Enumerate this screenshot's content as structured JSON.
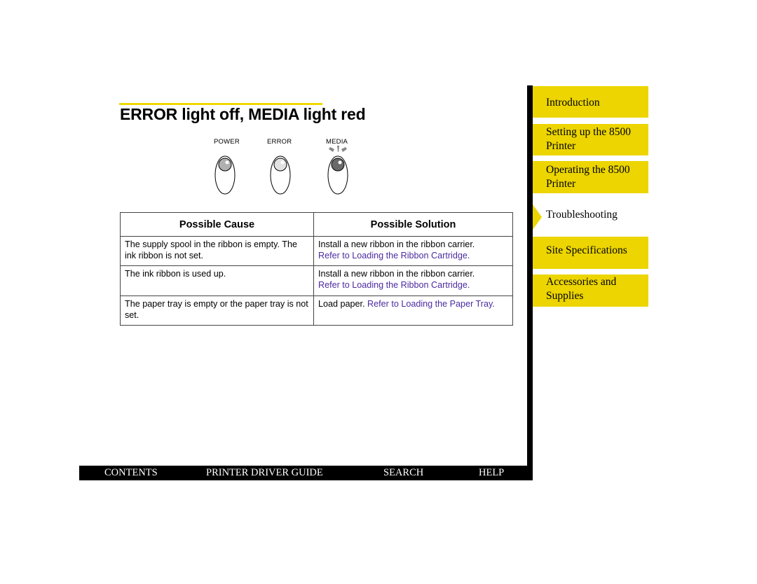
{
  "page": {
    "title": "ERROR light off, MEDIA light red"
  },
  "control_panel": {
    "leds": [
      {
        "label": "POWER",
        "state": "on",
        "color": "#b0b0b0"
      },
      {
        "label": "ERROR",
        "state": "off",
        "color": "#e2e2e2"
      },
      {
        "label": "MEDIA",
        "state": "lit",
        "color": "#6a6a6a"
      }
    ]
  },
  "table": {
    "headers": [
      "Possible Cause",
      "Possible Solution"
    ],
    "rows": [
      {
        "cause": "The supply spool in the ribbon is empty. The ink ribbon is not set.",
        "solution_text": "Install a new ribbon in the ribbon carrier.",
        "solution_link": "Refer to Loading the Ribbon Cartridge."
      },
      {
        "cause": "The ink ribbon is used up.",
        "solution_text": "Install a new ribbon in the ribbon carrier.",
        "solution_link": "Refer to Loading the Ribbon Cartridge."
      },
      {
        "cause": "The paper tray is empty or the paper tray is not set.",
        "solution_text": "Load paper.",
        "solution_link": "Refer to Loading the Paper Tray."
      }
    ]
  },
  "sidebar": {
    "items": [
      {
        "label": "Introduction",
        "active": false
      },
      {
        "label": "Setting up the 8500 Printer",
        "active": false
      },
      {
        "label": "Operating the 8500 Printer",
        "active": false
      },
      {
        "label": "Troubleshooting",
        "active": true
      },
      {
        "label": "Site Specifications",
        "active": false
      },
      {
        "label": "Accessories and Supplies",
        "active": false
      }
    ],
    "accent_color": "#ecd500"
  },
  "bottom_nav": {
    "items": [
      "CONTENTS",
      "PRINTER DRIVER GUIDE",
      "SEARCH",
      "HELP"
    ]
  },
  "colors": {
    "link": "#4b2aa0",
    "accent_yellow": "#ecd500"
  }
}
